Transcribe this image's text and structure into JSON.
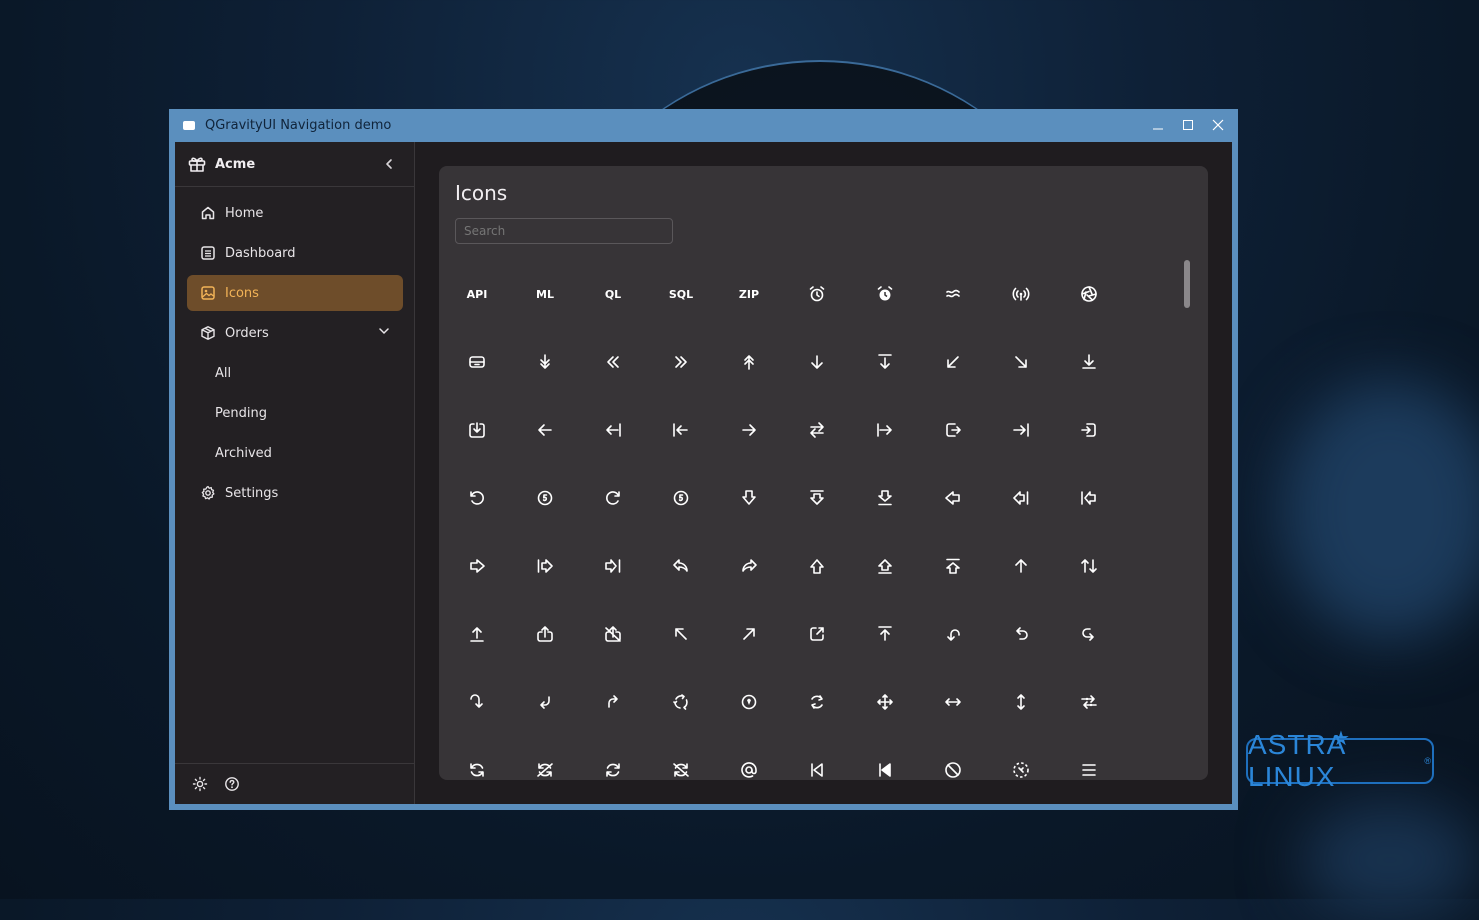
{
  "window": {
    "title": "QGravityUI Navigation demo"
  },
  "brand": {
    "name": "Acme"
  },
  "nav": {
    "home": "Home",
    "dashboard": "Dashboard",
    "icons": "Icons",
    "orders": "Orders",
    "orders_all": "All",
    "orders_pending": "Pending",
    "orders_archived": "Archived",
    "settings": "Settings"
  },
  "panel": {
    "title": "Icons",
    "search_placeholder": "Search"
  },
  "text_icons": [
    "API",
    "ML",
    "QL",
    "SQL",
    "ZIP"
  ],
  "icons": [
    [
      "api",
      "ml",
      "ql",
      "sql",
      "zip",
      "alarm-clock",
      "alarm-clock-fill",
      "approximately",
      "antenna",
      "aperture"
    ],
    [
      "archive",
      "arrow-down-double",
      "arrow-left-double",
      "arrow-right-double",
      "arrow-up-double",
      "arrow-down",
      "arrow-down-to-line",
      "arrow-down-left",
      "arrow-down-right",
      "arrow-down-to-bar"
    ],
    [
      "arrow-down-to-square",
      "arrow-left",
      "arrow-left-to-line",
      "arrow-left-from-line",
      "arrow-right",
      "arrow-right-arrow-left",
      "arrow-right-from-line",
      "arrow-right-from-square",
      "arrow-right-to-line",
      "arrow-right-to-square"
    ],
    [
      "arrow-rotate-left",
      "arrow-rotate-left-5",
      "arrow-rotate-right",
      "arrow-rotate-right-5",
      "arrow-shape-down",
      "arrow-shape-down-from-line",
      "arrow-shape-down-to-line",
      "arrow-shape-left",
      "arrow-shape-left-to-line",
      "arrow-shape-left-from-line"
    ],
    [
      "arrow-shape-right",
      "arrow-shape-right-from-line",
      "arrow-shape-right-to-line",
      "arrow-shape-turn-up-left",
      "arrow-shape-turn-up-right",
      "arrow-shape-up",
      "arrow-shape-up-to-line",
      "arrow-shape-up-from-line",
      "arrow-up",
      "arrows-up-down"
    ],
    [
      "arrow-up-to-bar",
      "arrow-up-from-square",
      "arrow-up-from-square-slash",
      "arrow-up-left",
      "arrow-up-right",
      "arrow-up-right-from-square",
      "arrow-up-to-line",
      "arrow-uturn-ccw-left",
      "arrow-uturn-ccw-up",
      "arrow-uturn-cw-right"
    ],
    [
      "arrow-uturn-cw-down",
      "arrow-uturn-ccw-down",
      "arrow-uturn-cw-up",
      "arrows-3-rotate-left",
      "arrows-3-rotate-right",
      "arrows-rotate-up",
      "arrows-expand",
      "arrows-left-right",
      "arrows-up-down-vertical",
      "arrows-opposite"
    ],
    [
      "arrows-rotate-left",
      "arrows-rotate-left-slash",
      "arrows-rotate-right",
      "arrows-rotate-right-slash",
      "at",
      "backward-step",
      "backward-step-fill",
      "ban",
      "circle-dashed",
      "bars"
    ]
  ]
}
